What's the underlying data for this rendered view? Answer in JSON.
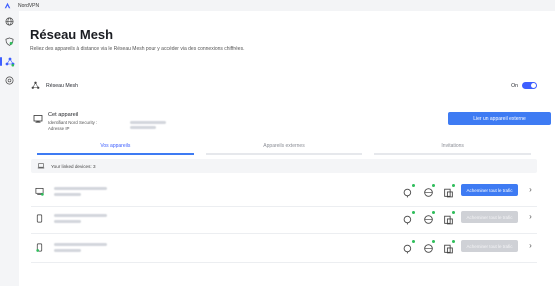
{
  "app": {
    "title": "NordVPN"
  },
  "rail": {
    "items": [
      {
        "name": "globe-icon"
      },
      {
        "name": "shield-icon"
      },
      {
        "name": "meshnet-icon",
        "active": true
      },
      {
        "name": "gauge-icon"
      }
    ]
  },
  "page": {
    "title": "Réseau Mesh",
    "subtitle": "Reliez des appareils à distance via le Réseau Mesh pour y accéder via des connexions chiffrées."
  },
  "mesh_toggle": {
    "label": "Réseau Mesh",
    "state_label": "On",
    "enabled": true
  },
  "this_device": {
    "name": "Cet appareil",
    "id_label": "Identifiant Nord Security :",
    "ip_label": "Adresse IP",
    "link_button": "Lier un appareil externe",
    "more_label": "···"
  },
  "tabs": [
    {
      "label": "Vos appareils",
      "active": true
    },
    {
      "label": "Appareils externes",
      "active": false
    },
    {
      "label": "Invitations",
      "active": false
    }
  ],
  "linked_devices": {
    "label": "Your linked devices: 3"
  },
  "devices": [
    {
      "icon": "desktop-device-icon",
      "route_label": "Acheminer tout le trafic",
      "route_enabled": true
    },
    {
      "icon": "phone-device-icon",
      "route_label": "Acheminer tout le trafic",
      "route_enabled": false
    },
    {
      "icon": "android-device-icon",
      "route_label": "Acheminer tout le trafic",
      "route_enabled": false
    }
  ],
  "colors": {
    "accent": "#3E5FFF",
    "button": "#3E7BF3",
    "success": "#2FBD5B",
    "disabled": "#CFD1D6"
  }
}
